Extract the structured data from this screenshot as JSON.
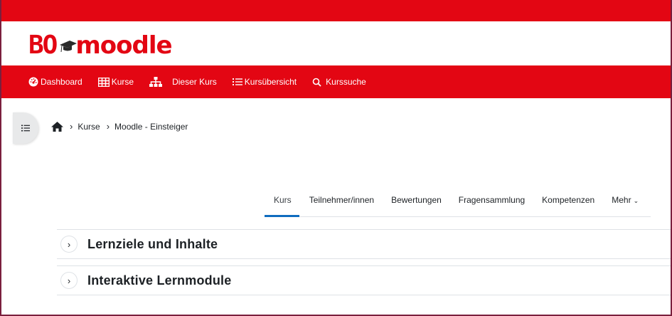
{
  "branding": {
    "logo_prefix": "BO",
    "logo_name": "moodle",
    "brand_color": "#e30613",
    "accent_color": "#0f6cbf"
  },
  "nav": {
    "items": [
      {
        "label": "Dashboard",
        "icon": "dashboard-icon"
      },
      {
        "label": "Kurse",
        "icon": "grid-icon"
      },
      {
        "label": "Dieser Kurs",
        "icon": "sitemap-icon"
      },
      {
        "label": "Kursübersicht",
        "icon": "list-icon"
      },
      {
        "label": "Kurssuche",
        "icon": "search-icon"
      }
    ]
  },
  "breadcrumb": {
    "items": [
      "Kurse",
      "Moodle - Einsteiger"
    ]
  },
  "tabs": [
    {
      "label": "Kurs",
      "active": true
    },
    {
      "label": "Teilnehmer/innen"
    },
    {
      "label": "Bewertungen"
    },
    {
      "label": "Fragensammlung"
    },
    {
      "label": "Kompetenzen"
    },
    {
      "label": "Mehr"
    }
  ],
  "sections": [
    {
      "title": "Lernziele und Inhalte"
    },
    {
      "title": "Interaktive Lernmodule"
    }
  ]
}
